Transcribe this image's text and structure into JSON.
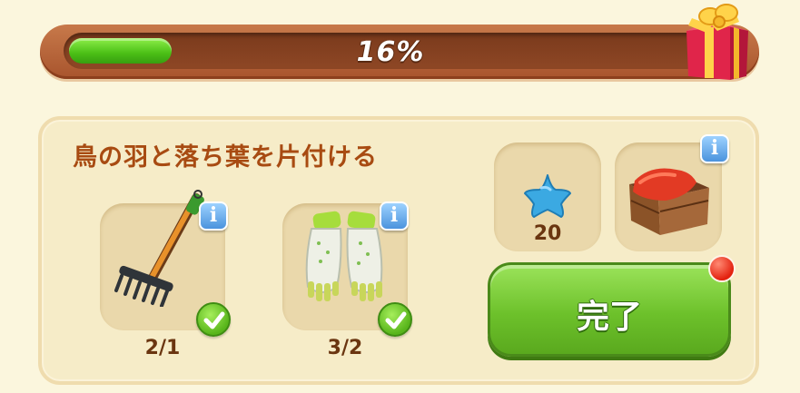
{
  "progress": {
    "percent_text": "16%",
    "value": 0.16
  },
  "task": {
    "title": "鳥の羽と落ち葉を片付ける",
    "requirements": [
      {
        "icon": "rake-icon",
        "count": "2/1",
        "completed": true
      },
      {
        "icon": "gardening-gloves-icon",
        "count": "3/2",
        "completed": true
      }
    ]
  },
  "rewards": [
    {
      "icon": "blue-star-icon",
      "amount": "20"
    },
    {
      "icon": "wooden-crate-icon",
      "amount": ""
    }
  ],
  "done_button": {
    "label": "完了"
  },
  "colors": {
    "progress_fill": "#4bbf16",
    "title": "#a84b12",
    "done_button": "#6dc12b",
    "notification": "#e3210f",
    "info": "#4b93dd"
  }
}
